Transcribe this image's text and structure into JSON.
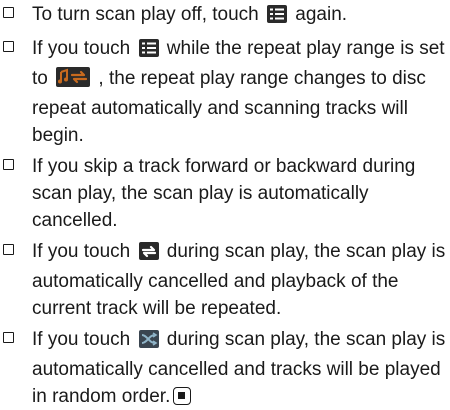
{
  "notes": [
    {
      "pre": "To turn scan play off, touch",
      "post": "again."
    },
    {
      "pre": "If you touch",
      "mid": "while the repeat play range is set to",
      "post": ", the repeat play range changes to disc repeat automatically and scanning tracks will begin."
    },
    {
      "text": "If you skip a track forward or backward during scan play, the scan play is automatically cancelled."
    },
    {
      "pre": "If you touch",
      "post": "during scan play, the scan play is automatically cancelled and playback of the current track will be repeated."
    },
    {
      "pre": "If you touch",
      "post": "during scan play, the scan play is automatically cancelled and tracks will be played in random order."
    }
  ],
  "icons": {
    "scan": "scan-play-icon",
    "repeat_range": "folder-repeat-icon",
    "repeat": "repeat-icon",
    "random": "random-icon",
    "end": "end-of-section-icon"
  },
  "colors": {
    "icon_bg": "#2a2a2a",
    "icon_fg": "#ffffff",
    "repeat_range_accent": "#c86a1e",
    "random_accent": "#8fb4c8"
  }
}
